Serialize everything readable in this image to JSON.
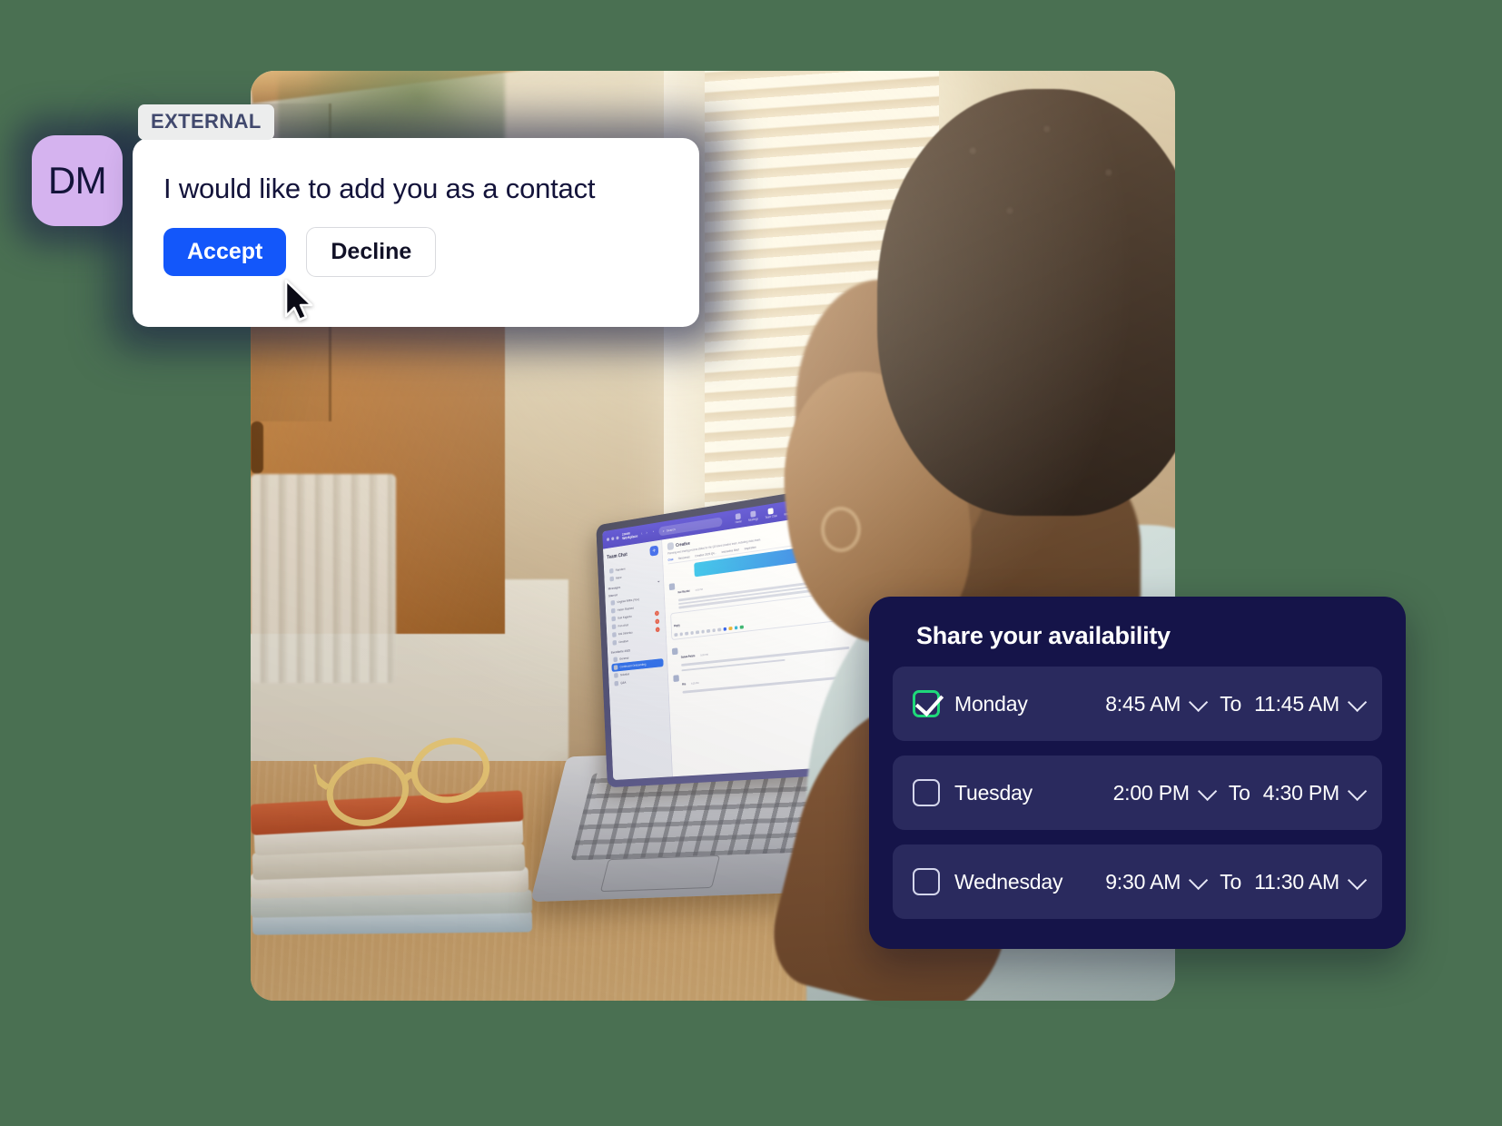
{
  "theme": {
    "page_background": "#4a7052",
    "accent_blue": "#1357fa",
    "panel_navy": "#151449",
    "panel_row_navy": "#2a2a5e",
    "checkbox_green": "#1fd87a",
    "avatar_purple": "#d5b3ef",
    "badge_gray": "#eceded",
    "badge_text": "#41496e"
  },
  "contact_request": {
    "avatar_initials": "DM",
    "badge_label": "EXTERNAL",
    "message": "I would like to add you as a contact",
    "accept_label": "Accept",
    "decline_label": "Decline",
    "cursor": "pointer-arrow-icon"
  },
  "availability": {
    "title": "Share your availability",
    "to_label": "To",
    "rows": [
      {
        "day": "Monday",
        "checked": true,
        "start": "8:45 AM",
        "end": "11:45 AM"
      },
      {
        "day": "Tuesday",
        "checked": false,
        "start": "2:00 PM",
        "end": "4:30 PM"
      },
      {
        "day": "Wednesday",
        "checked": false,
        "start": "9:30 AM",
        "end": "11:30 AM"
      }
    ]
  },
  "photo": {
    "description": "Man at a desk by a sunlit window, hand to his head, looking at a laptop running a team chat app",
    "laptop_app": {
      "brand_line1": "zoom",
      "brand_line2": "Workplace",
      "search_placeholder": "Search",
      "nav": [
        {
          "label": "Home",
          "active": false
        },
        {
          "label": "Meetings",
          "active": false
        },
        {
          "label": "Team Chat",
          "active": true
        },
        {
          "label": "Whiteboard",
          "active": false
        },
        {
          "label": "More",
          "active": false
        }
      ],
      "sidebar": {
        "title": "Team Chat",
        "add_label": "+",
        "sections": [
          {
            "label": "Starred"
          },
          {
            "label": "Messages"
          }
        ],
        "items": [
          {
            "label": "Random",
            "badge": ""
          },
          {
            "label": "More",
            "badge": ""
          },
          {
            "label": "Virginia Willis (You)",
            "badge": ""
          },
          {
            "label": "Helen Rashed",
            "badge": ""
          },
          {
            "label": "Sun Kajanto",
            "badge": "2"
          },
          {
            "label": "Fun chat",
            "badge": "3"
          },
          {
            "label": "Kai Jimenko",
            "badge": "1"
          },
          {
            "label": "Creative",
            "badge": ""
          },
          {
            "label": "Eventbrite 2025",
            "badge": ""
          },
          {
            "label": "General",
            "badge": ""
          },
          {
            "label": "Continued Onboarding",
            "badge": "",
            "selected": true
          },
          {
            "label": "Solution",
            "badge": ""
          },
          {
            "label": "Q&A",
            "badge": ""
          }
        ]
      },
      "channel": {
        "name": "Creative",
        "subtitle": "Planning and sharing process status for the Q3 brand creative team, including video team.",
        "tabs": [
          {
            "label": "Chat",
            "active": true
          },
          {
            "label": "Resources",
            "active": false
          },
          {
            "label": "Creative 2025 Q4...",
            "active": false
          },
          {
            "label": "Interactive Brief",
            "active": false
          },
          {
            "label": "Inspiration",
            "active": false
          }
        ],
        "messages": [
          {
            "author": "Kai Rashid",
            "time": "4:05 PM",
            "body": "I just wanted to take a moment to express how much I have enjoyed working with your team. The collaboration has been an absolute pleasure, and I truly appreciate the dedication and expertise that you all bring to the table."
          },
          {
            "author": "Sanaa Patels",
            "time": "5:20 PM",
            "body": "I wanted to check in on the progress of the latest project."
          },
          {
            "author": "",
            "time": "",
            "body": "How's the project coming along?"
          },
          {
            "author": "Rio",
            "time": "5:25 PM",
            "body": "It's going well, we're on track to meet the deadline."
          }
        ],
        "reply_placeholder": "Reply",
        "system_note": "Team Chat added Kai here"
      }
    }
  }
}
